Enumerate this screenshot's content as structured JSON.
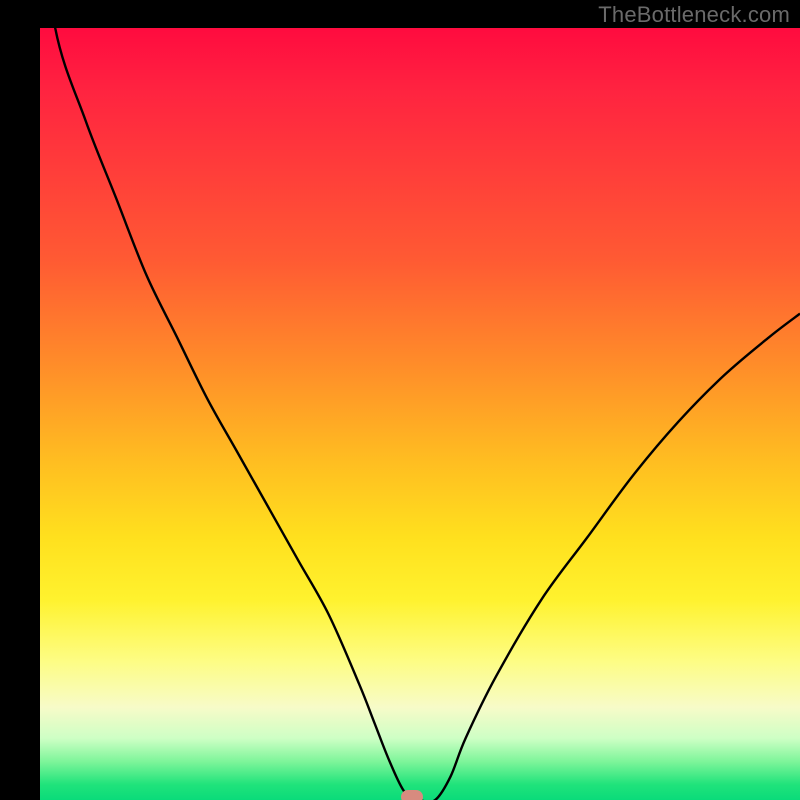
{
  "watermark": "TheBottleneck.com",
  "colors": {
    "background": "#000000",
    "watermark": "#6a6a6a",
    "curve": "#000000",
    "marker": "#d78b7f",
    "gradient_top": "#ff0b3f",
    "gradient_bottom": "#0adb7a"
  },
  "chart_data": {
    "type": "line",
    "title": "",
    "xlabel": "",
    "ylabel": "",
    "xlim": [
      0,
      100
    ],
    "ylim": [
      0,
      100
    ],
    "annotations": [
      {
        "type": "marker",
        "x": 49,
        "y": 0,
        "label": "optimal-point"
      }
    ],
    "series": [
      {
        "name": "bottleneck-curve",
        "x": [
          0,
          2,
          6,
          10,
          14,
          18,
          22,
          26,
          30,
          34,
          38,
          42,
          44,
          46,
          48,
          50,
          52,
          54,
          56,
          60,
          66,
          72,
          78,
          84,
          90,
          96,
          100
        ],
        "y": [
          118,
          100,
          88,
          78,
          68,
          60,
          52,
          45,
          38,
          31,
          24,
          15,
          10,
          5,
          1,
          0,
          0,
          3,
          8,
          16,
          26,
          34,
          42,
          49,
          55,
          60,
          63
        ]
      }
    ],
    "grid": false,
    "legend": false
  }
}
